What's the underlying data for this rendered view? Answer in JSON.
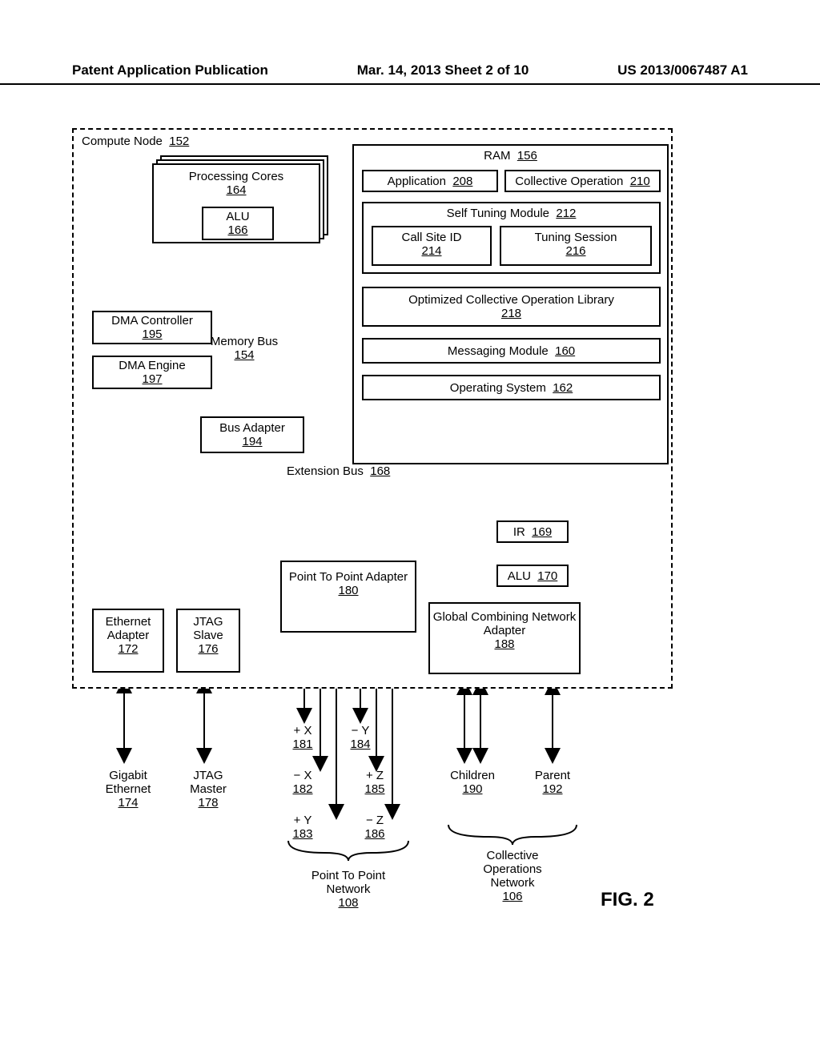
{
  "header": {
    "left": "Patent Application Publication",
    "center": "Mar. 14, 2013  Sheet 2 of 10",
    "right": "US 2013/0067487 A1"
  },
  "compute_node": {
    "title": "Compute Node",
    "num": "152"
  },
  "processing_cores": {
    "title": "Processing Cores",
    "num": "164"
  },
  "alu": {
    "title": "ALU",
    "num": "166"
  },
  "dma_ctrl": {
    "title": "DMA Controller",
    "num": "195"
  },
  "dma_eng": {
    "title": "DMA Engine",
    "num": "197"
  },
  "mem_bus": {
    "title": "Memory Bus",
    "num": "154"
  },
  "bus_adapter": {
    "title": "Bus Adapter",
    "num": "194"
  },
  "ram": {
    "title": "RAM",
    "num": "156"
  },
  "application": {
    "title": "Application",
    "num": "208"
  },
  "collective_op": {
    "title": "Collective Operation",
    "num": "210"
  },
  "self_tuning": {
    "title": "Self Tuning Module",
    "num": "212"
  },
  "call_site": {
    "title": "Call Site ID",
    "num": "214"
  },
  "tuning_session": {
    "title": "Tuning Session",
    "num": "216"
  },
  "opt_lib": {
    "title": "Optimized Collective Operation Library",
    "num": "218"
  },
  "msg_mod": {
    "title": "Messaging Module",
    "num": "160"
  },
  "os": {
    "title": "Operating System",
    "num": "162"
  },
  "ext_bus": {
    "title": "Extension Bus",
    "num": "168"
  },
  "ir": {
    "title": "IR",
    "num": "169"
  },
  "alu2": {
    "title": "ALU",
    "num": "170"
  },
  "p2p_adapter": {
    "title": "Point To Point Adapter",
    "num": "180"
  },
  "eth_adapter": {
    "title": "Ethernet Adapter",
    "num": "172"
  },
  "jtag_slave": {
    "title": "JTAG Slave",
    "num": "176"
  },
  "gcn_adapter": {
    "title": "Global Combining Network Adapter",
    "num": "188"
  },
  "gig_eth": {
    "title": "Gigabit Ethernet",
    "num": "174"
  },
  "jtag_master": {
    "title": "JTAG Master",
    "num": "178"
  },
  "px": {
    "title": "+ X",
    "num": "181"
  },
  "nx": {
    "title": "− X",
    "num": "182"
  },
  "py": {
    "title": "+ Y",
    "num": "183"
  },
  "ny": {
    "title": "− Y",
    "num": "184"
  },
  "pz": {
    "title": "+ Z",
    "num": "185"
  },
  "nz": {
    "title": "− Z",
    "num": "186"
  },
  "children": {
    "title": "Children",
    "num": "190"
  },
  "parent": {
    "title": "Parent",
    "num": "192"
  },
  "p2p_net": {
    "title": "Point To Point Network",
    "num": "108"
  },
  "col_net": {
    "title": "Collective Operations Network",
    "num": "106"
  },
  "fig": "FIG. 2"
}
